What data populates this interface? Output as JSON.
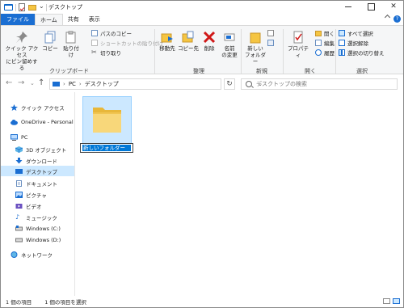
{
  "window": {
    "title": "デスクトップ"
  },
  "tabs": [
    {
      "label": "ファイル"
    },
    {
      "label": "ホーム"
    },
    {
      "label": "共有"
    },
    {
      "label": "表示"
    }
  ],
  "ribbon": {
    "clipboard": {
      "pin_label": "クイック アクセス\nにピン留めする",
      "pin_line1": "クイック アクセス",
      "pin_line2": "にピン留めする",
      "copy_label": "コピー",
      "paste_label": "貼り付け",
      "copy_path": "パスのコピー",
      "paste_shortcut": "ショートカットの貼り付け",
      "cut": "切り取り",
      "group_label": "クリップボード"
    },
    "organize": {
      "move_to": "移動先",
      "copy_to": "コピー先",
      "delete": "削除",
      "rename_line1": "名前",
      "rename_line2": "の変更",
      "group_label": "整理"
    },
    "new": {
      "new_folder_line1": "新しい",
      "new_folder_line2": "フォルダー",
      "group_label": "新規"
    },
    "open": {
      "properties": "プロパティ",
      "open": "開く",
      "edit": "編集",
      "history": "履歴",
      "group_label": "開く"
    },
    "select": {
      "select_all": "すべて選択",
      "select_none": "選択解除",
      "invert": "選択の切り替え",
      "group_label": "選択"
    }
  },
  "address": {
    "segments": [
      "PC",
      "デスクトップ"
    ],
    "search_placeholder": "デスクトップの検索"
  },
  "nav_pane": {
    "items": [
      {
        "label": "クイック アクセス",
        "icon": "star-icon"
      },
      {
        "label": "OneDrive - Personal",
        "icon": "cloud-icon"
      },
      {
        "label": "PC",
        "icon": "pc-icon"
      },
      {
        "label": "3D オブジェクト",
        "icon": "cube-icon"
      },
      {
        "label": "ダウンロード",
        "icon": "download-icon"
      },
      {
        "label": "デスクトップ",
        "icon": "desktop-icon"
      },
      {
        "label": "ドキュメント",
        "icon": "document-icon"
      },
      {
        "label": "ピクチャ",
        "icon": "picture-icon"
      },
      {
        "label": "ビデオ",
        "icon": "video-icon"
      },
      {
        "label": "ミュージック",
        "icon": "music-icon"
      },
      {
        "label": "Windows (C:)",
        "icon": "drive-icon"
      },
      {
        "label": "Windows (D:)",
        "icon": "drive-icon"
      },
      {
        "label": "ネットワーク",
        "icon": "network-icon"
      }
    ]
  },
  "content": {
    "rename_value": "新しいフォルダー"
  },
  "status": {
    "item_count": "1 個の項目",
    "selected": "1 個の項目を選択"
  },
  "colors": {
    "accent": "#1a6ed2",
    "selection": "#cce8ff",
    "folder": "#f5c542"
  }
}
